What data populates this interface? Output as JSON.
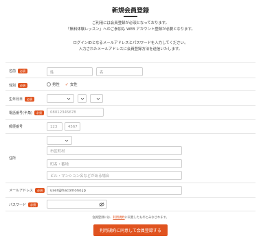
{
  "page": {
    "title": "新規会員登録",
    "intro": [
      "ご利用には会員登録が必須となっております。",
      "「無料体験レッスン」へのご参加も WEB アカウント登録が必要となります。",
      "ログインIDとなるメールアドレスとパスワードを入力してください。",
      "入力されたメールアドレスに会員登録方法を送信いたします。"
    ]
  },
  "required_badge": "必須",
  "form": {
    "name": {
      "label": "名前",
      "last_placeholder": "姓",
      "first_placeholder": "名"
    },
    "gender": {
      "label": "性別",
      "option_male": "男性",
      "option_female": "女性",
      "selected": "女性"
    },
    "birthdate": {
      "label": "生年月日"
    },
    "phone": {
      "label": "電話番号(半角)",
      "placeholder": "08012345678"
    },
    "postal": {
      "label": "郵便番号",
      "part1_placeholder": "123",
      "part2_placeholder": "4567"
    },
    "address": {
      "label": "住所",
      "city_placeholder": "市区町村",
      "town_placeholder": "町名・番地",
      "building_placeholder": "ビル・マンション名などがある場合"
    },
    "email": {
      "label": "メールアドレス",
      "value": "user@hacomono.jp"
    },
    "password": {
      "label": "パスワード"
    }
  },
  "terms": {
    "prefix": "会員登録には、",
    "link": "利用規約",
    "suffix": "に同意したものとみなされます。"
  },
  "submit_label": "利用規約に同意して会員登録する",
  "colors": {
    "accent": "#e0531f"
  }
}
